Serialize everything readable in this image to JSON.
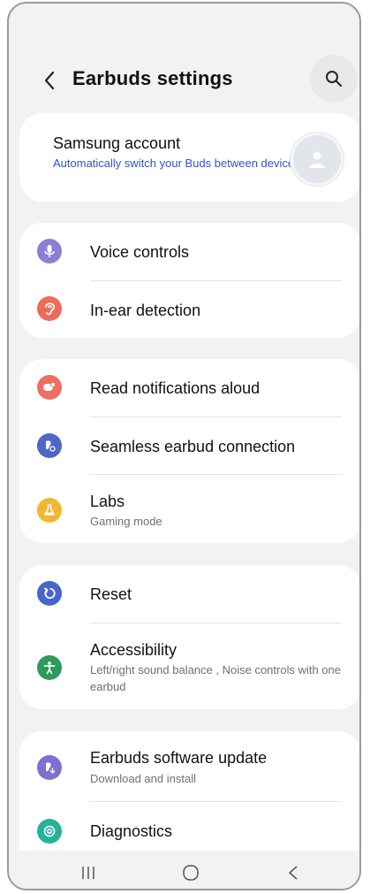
{
  "header": {
    "title": "Earbuds settings"
  },
  "account": {
    "title": "Samsung account",
    "subtitle": "Automatically switch your Buds between devices"
  },
  "group1": [
    {
      "label": "Voice controls",
      "icon": "microphone-icon",
      "color": "#8a7fd6"
    },
    {
      "label": "In-ear detection",
      "icon": "ear-icon",
      "color": "#ee6a5b"
    }
  ],
  "group2": [
    {
      "label": "Read notifications aloud",
      "icon": "notification-icon",
      "color": "#ef6e62"
    },
    {
      "label": "Seamless earbud connection",
      "icon": "earbud-connection-icon",
      "color": "#4d67c9"
    },
    {
      "label": "Labs",
      "sub": "Gaming mode",
      "icon": "flask-icon",
      "color": "#f4b531"
    }
  ],
  "group3": [
    {
      "label": "Reset",
      "icon": "reset-icon",
      "color": "#4666cc"
    },
    {
      "label": "Accessibility",
      "sub": "Left/right sound balance , Noise controls with one earbud",
      "icon": "accessibility-icon",
      "color": "#2e9a5b"
    }
  ],
  "group4": [
    {
      "label": "Earbuds software update",
      "sub": "Download and install",
      "icon": "software-update-icon",
      "color": "#7e6fd0"
    },
    {
      "label": "Diagnostics",
      "icon": "diagnostics-icon",
      "color": "#24b39a"
    }
  ]
}
